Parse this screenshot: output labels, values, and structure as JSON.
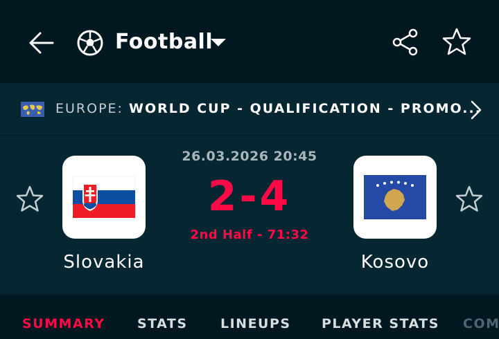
{
  "header": {
    "sport_title": "Football",
    "icons": [
      "back-arrow-icon",
      "football-icon",
      "chevron-down-icon",
      "share-icon",
      "star-icon"
    ]
  },
  "competition": {
    "country": "EUROPE:",
    "name": "WORLD CUP - QUALIFICATION - PROMO..."
  },
  "match": {
    "datetime": "26.03.2026 20:45",
    "score": "2-4",
    "status": "2nd Half - 71:32",
    "home": {
      "name": "Slovakia"
    },
    "away": {
      "name": "Kosovo"
    }
  },
  "tabs": [
    {
      "label": "SUMMARY",
      "active": true
    },
    {
      "label": "STATS",
      "active": false
    },
    {
      "label": "LINEUPS",
      "active": false
    },
    {
      "label": "PLAYER STATS",
      "active": false
    },
    {
      "label": "COM",
      "active": false
    }
  ],
  "colors": {
    "background": "#031c25",
    "accent": "#ff0a46",
    "text": "#ffffff"
  }
}
